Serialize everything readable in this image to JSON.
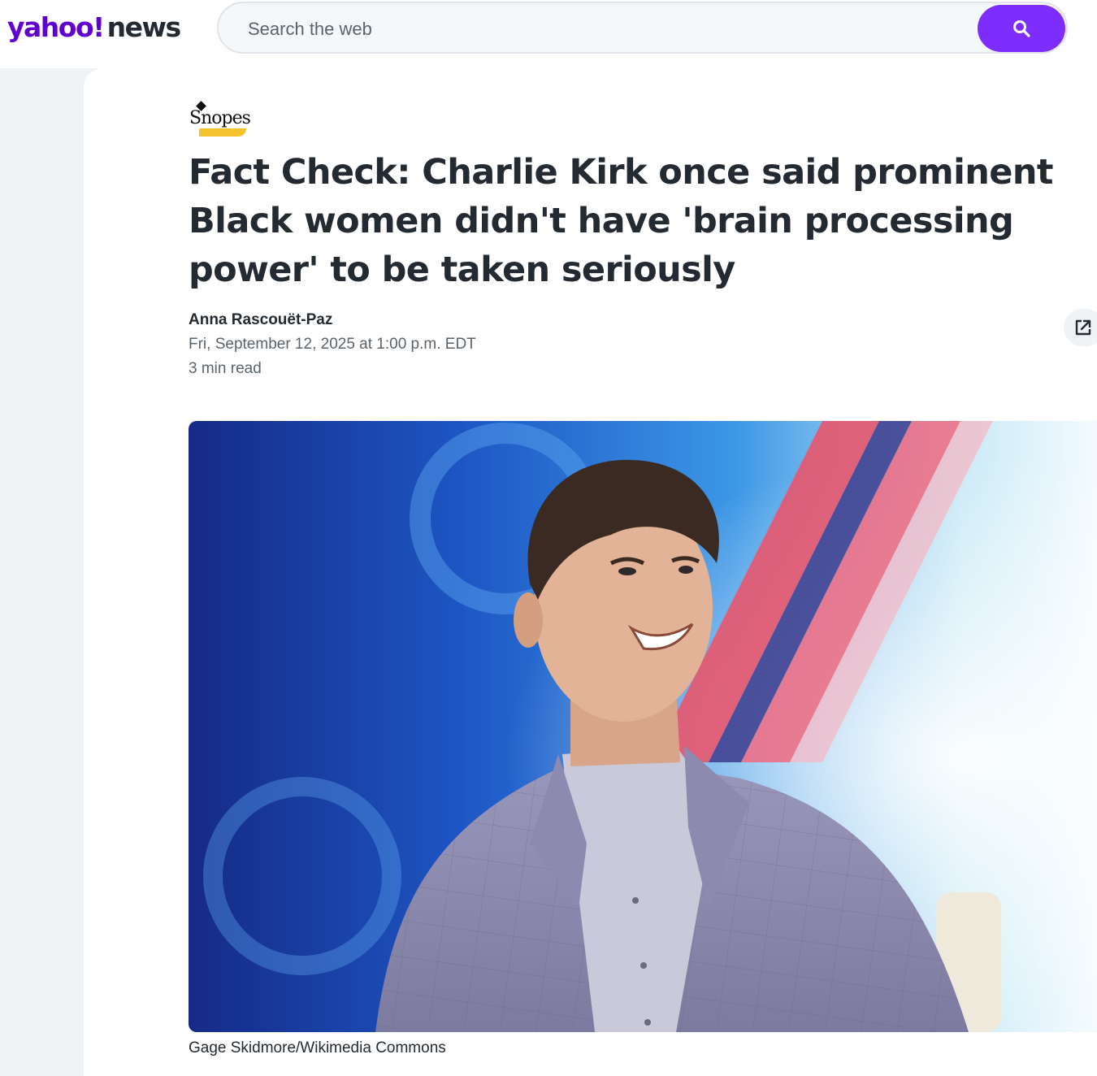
{
  "header": {
    "logo_yahoo": "yahoo!",
    "logo_news": "news",
    "search_placeholder": "Search the web"
  },
  "article": {
    "source": "Snopes",
    "headline": "Fact Check: Charlie Kirk once said prominent Black women didn't have 'brain processing power' to be taken seriously",
    "author": "Anna Rascouët-Paz",
    "date": "Fri, September 12, 2025 at 1:00 p.m. EDT",
    "read_time": "3 min read",
    "image_caption": "Gage Skidmore/Wikimedia Commons"
  },
  "colors": {
    "brand_purple": "#6001d2",
    "search_button": "#7d2eff"
  },
  "icons": {
    "search": "search-icon",
    "share": "share-icon"
  }
}
